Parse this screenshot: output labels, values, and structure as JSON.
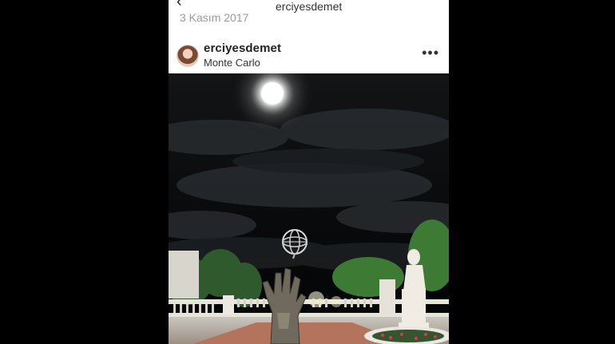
{
  "top": {
    "back_icon": "chevron-left-icon",
    "date": "3 Kasım 2017",
    "username": "erciyesdemet"
  },
  "post": {
    "username": "erciyesdemet",
    "location": "Monte Carlo",
    "more_icon": "more-horizontal-icon",
    "more_glyph": "•••"
  }
}
